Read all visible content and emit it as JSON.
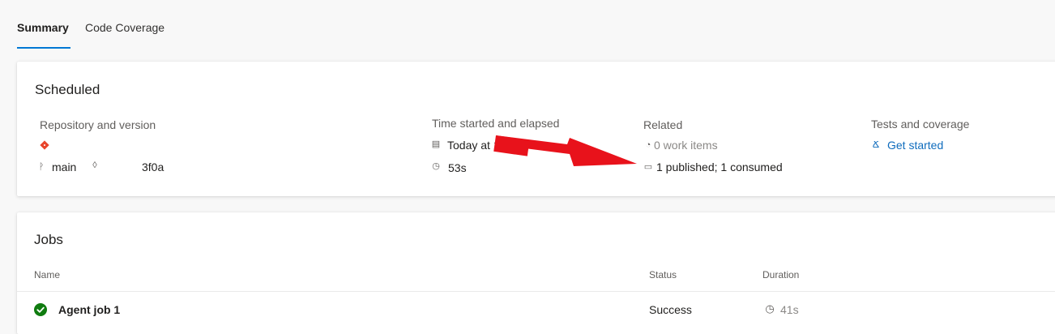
{
  "tabs": [
    {
      "label": "Summary",
      "active": true
    },
    {
      "label": "Code Coverage",
      "active": false
    }
  ],
  "summary": {
    "title": "Scheduled",
    "repository": {
      "label": "Repository and version",
      "icon": "git-icon",
      "branch": "main",
      "commit": "3f0a"
    },
    "time": {
      "label": "Time started and elapsed",
      "started": "Today at 1",
      "elapsed": "53s"
    },
    "related": {
      "label": "Related",
      "work_items": "0 work items",
      "artifacts": "1 published; 1 consumed"
    },
    "tests": {
      "label": "Tests and coverage",
      "link": "Get started"
    }
  },
  "jobs": {
    "title": "Jobs",
    "columns": {
      "name": "Name",
      "status": "Status",
      "duration": "Duration"
    },
    "rows": [
      {
        "name": "Agent job 1",
        "status": "Success",
        "duration": "41s"
      }
    ]
  },
  "colors": {
    "accent": "#0078d4",
    "success": "#107c10",
    "git": "#e8452c",
    "annotation_arrow": "#e8121b"
  }
}
